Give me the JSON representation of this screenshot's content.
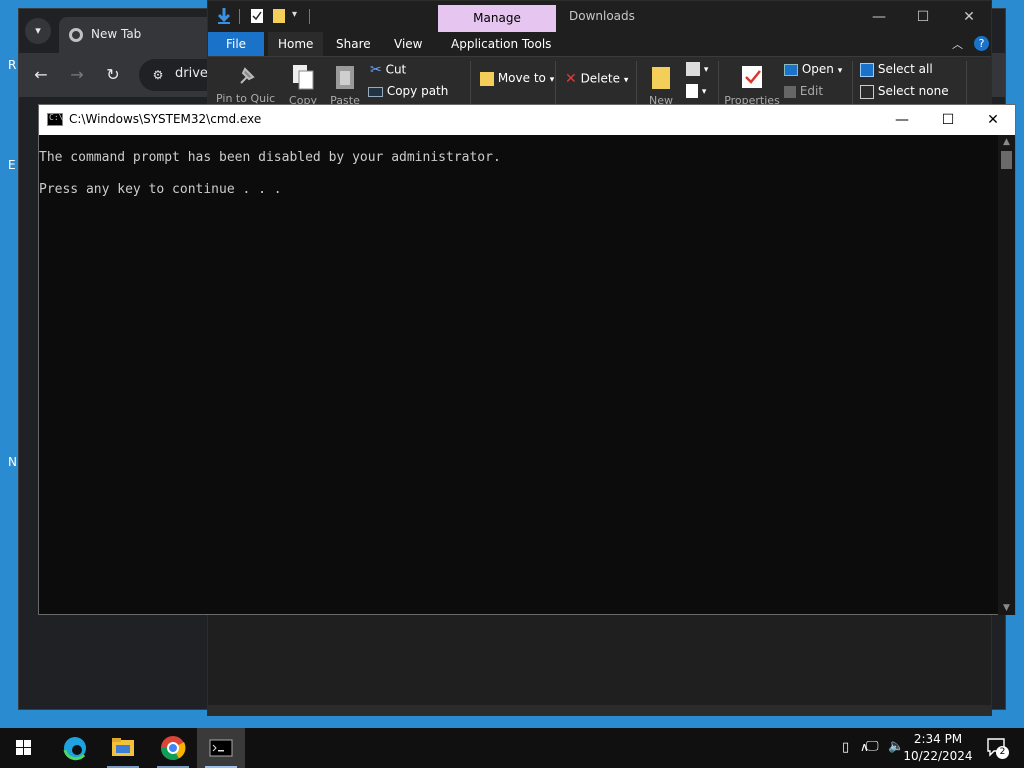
{
  "desktop": {
    "fragments": [
      "R",
      "E",
      "N"
    ]
  },
  "chrome": {
    "tab_title": "New Tab",
    "url": "drive."
  },
  "explorer": {
    "manage_label": "Manage",
    "window_title": "Downloads",
    "tabs": [
      "File",
      "Home",
      "Share",
      "View",
      "Application Tools"
    ],
    "ribbon": {
      "pin": "Pin to Quick",
      "copy": "Copy",
      "paste": "Paste",
      "cut": "Cut",
      "copy_path": "Copy path",
      "move_to": "Move to",
      "delete": "Delete",
      "new_folder": "New",
      "properties": "Properties",
      "open": "Open",
      "edit": "Edit",
      "select_all": "Select all",
      "select_none": "Select none"
    }
  },
  "cmd": {
    "title": "C:\\Windows\\SYSTEM32\\cmd.exe",
    "lines": [
      "The command prompt has been disabled by your administrator.",
      "",
      "Press any key to continue . . ."
    ]
  },
  "taskbar": {
    "time": "2:34 PM",
    "date": "10/22/2024",
    "notification_count": "2"
  },
  "colors": {
    "explorer_file_tab": "#1a73c9",
    "manage_tab": "#e6c6f0",
    "console_bg": "#0c0c0c",
    "console_text": "#cccccc"
  }
}
